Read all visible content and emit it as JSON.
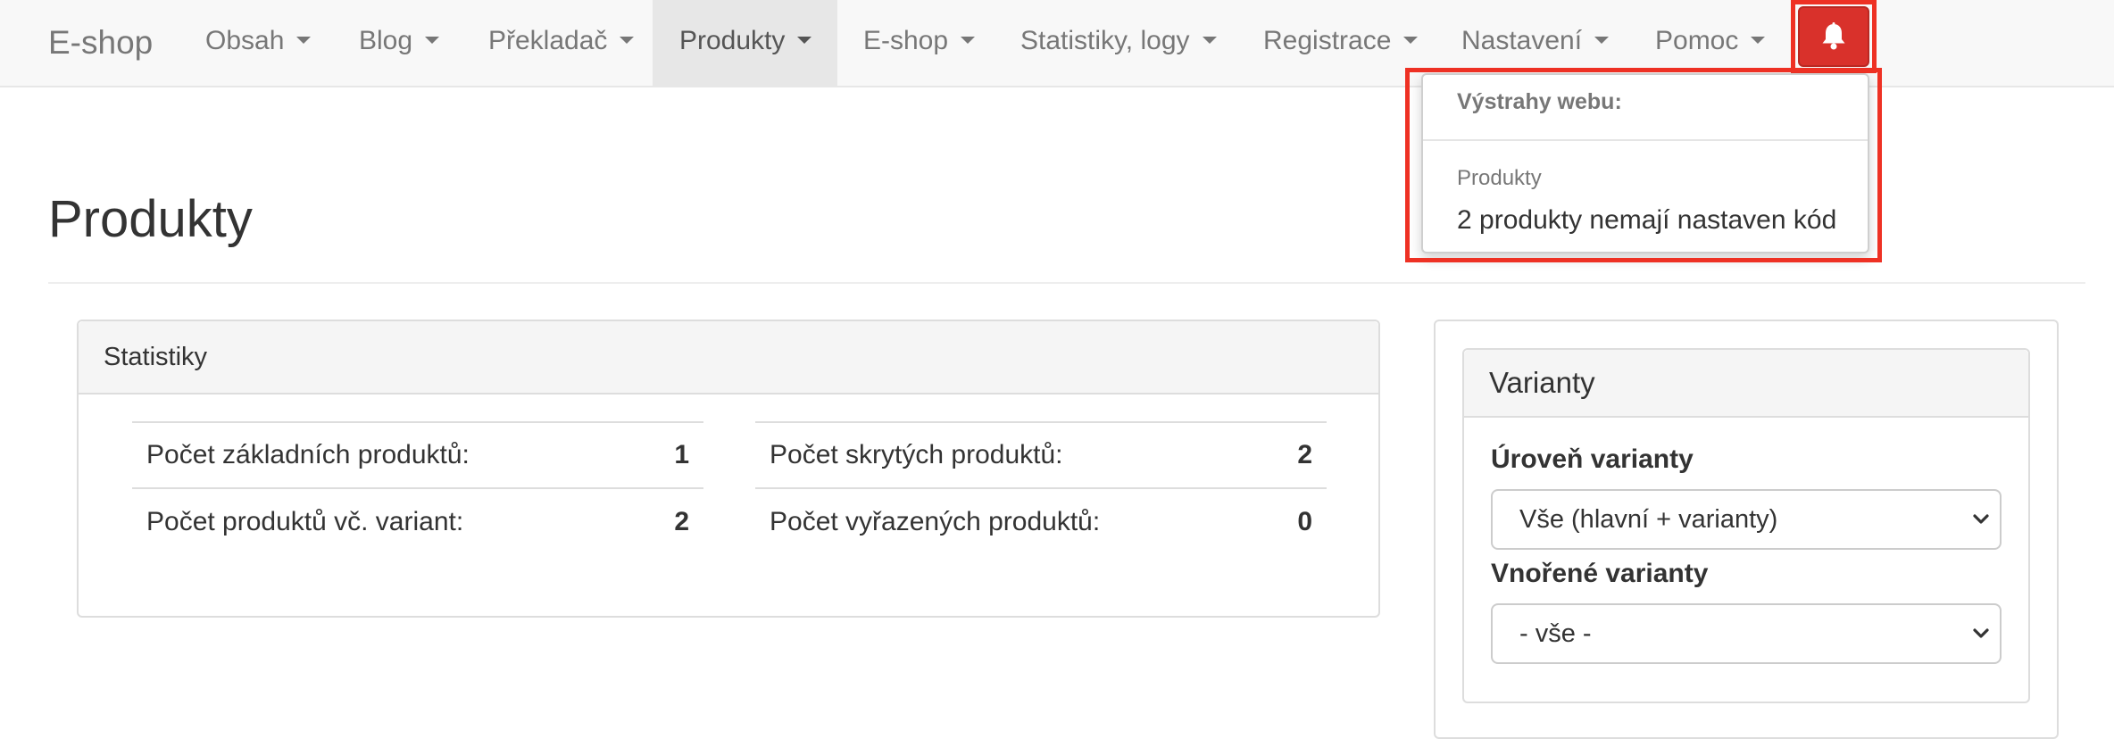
{
  "navbar": {
    "brand": "E-shop",
    "items": [
      {
        "label": "Obsah"
      },
      {
        "label": "Blog"
      },
      {
        "label": "Překladač"
      },
      {
        "label": "Produkty"
      },
      {
        "label": "E-shop"
      },
      {
        "label": "Statistiky, logy"
      },
      {
        "label": "Registrace"
      },
      {
        "label": "Nastavení"
      },
      {
        "label": "Pomoc"
      }
    ],
    "active_item": "Produkty",
    "bell_icon": "bell-icon"
  },
  "alerts": {
    "header": "Výstrahy webu:",
    "category": "Produkty",
    "message": "2 produkty nemají nastaven kód"
  },
  "page": {
    "title": "Produkty"
  },
  "stats": {
    "title": "Statistiky",
    "left": [
      {
        "label": "Počet základních produktů:",
        "value": "1"
      },
      {
        "label": "Počet produktů vč. variant:",
        "value": "2"
      }
    ],
    "right": [
      {
        "label": "Počet skrytých produktů:",
        "value": "2"
      },
      {
        "label": "Počet vyřazených produktů:",
        "value": "0"
      }
    ]
  },
  "variants": {
    "title": "Varianty",
    "level_label": "Úroveň varianty",
    "level_value": "Vše (hlavní + varianty)",
    "nested_label": "Vnořené varianty",
    "nested_value": "- vše -"
  },
  "colors": {
    "accent_red": "#d9312b",
    "highlight_border": "#ee3124",
    "navbar_bg": "#f8f8f8"
  }
}
